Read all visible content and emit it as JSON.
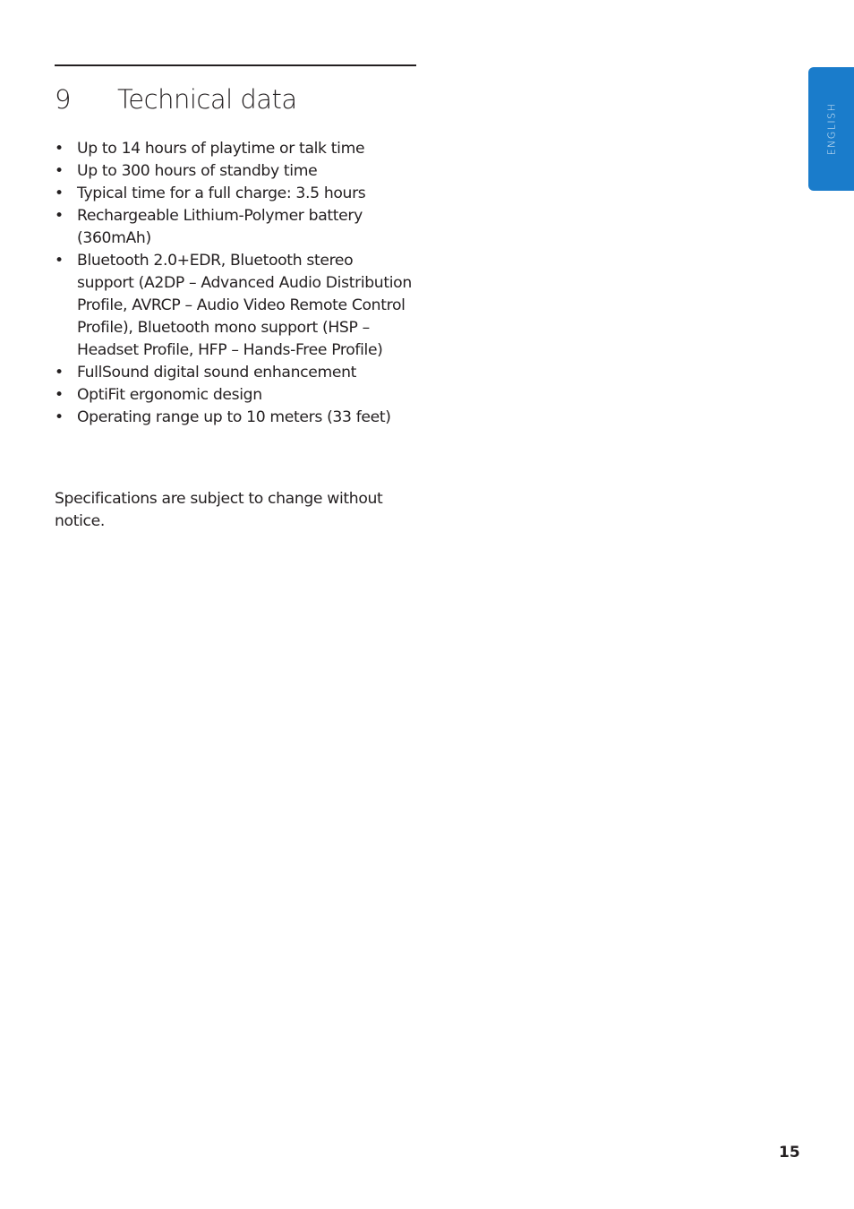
{
  "section": {
    "number": "9",
    "title": "Technical data"
  },
  "specs": [
    "Up to 14 hours of playtime or talk time",
    "Up to 300 hours of standby time",
    "Typical time for a full charge: 3.5 hours",
    "Rechargeable Lithium-Polymer battery (360mAh)",
    "Bluetooth 2.0+EDR, Bluetooth stereo support (A2DP – Advanced Audio Distribution Profile, AVRCP – Audio Video Remote Control Profile), Bluetooth mono support (HSP – Headset Profile, HFP – Hands-Free Profile)",
    "FullSound digital sound enhancement",
    "OptiFit ergonomic design",
    "Operating range up to 10 meters (33 feet)"
  ],
  "bullet_glyph": "•",
  "note": "Specifications are subject to change without notice.",
  "language_tab": {
    "label": "ENGLISH",
    "color": "#1a7ccb"
  },
  "page_number": "15"
}
